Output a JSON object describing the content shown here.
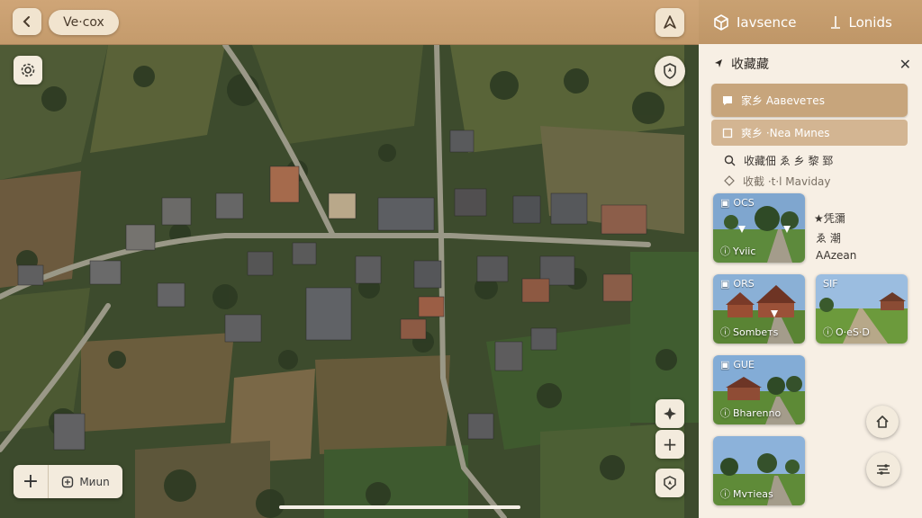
{
  "topbar": {
    "title": "Ve·cox"
  },
  "sidebar": {
    "tabs": [
      {
        "label": "Iavsence",
        "icon": "cube-icon"
      },
      {
        "label": "Lonids",
        "icon": "pin-icon"
      }
    ],
    "header": {
      "title": "收藏藏"
    },
    "rows": [
      {
        "label": "家乡 Aавеveтes"
      },
      {
        "label": "爽乡 ·Nea Mиnes"
      },
      {
        "label": "收藏佃 ゑ 乡 黎 郅"
      },
      {
        "label": "收截 ·t·l Mavіdаy"
      }
    ],
    "cards": [
      {
        "tag": "ОСS",
        "caption": "Yviic"
      },
      {
        "tag": "ОRS",
        "caption": "Sоmbетs"
      },
      {
        "tag": "SIF",
        "caption": "O·eS·D"
      },
      {
        "tag": "GUE",
        "caption": "Вhаrеnnо"
      },
      {
        "tag": "",
        "caption": "Мvтiеаs"
      }
    ],
    "notes": [
      "★凭瀰",
      "ゑ 潮",
      "AAzеаn"
    ]
  },
  "map": {
    "label": "Mиun"
  },
  "colors": {
    "accent": "#c49b6c",
    "panel": "#f7efe4"
  }
}
